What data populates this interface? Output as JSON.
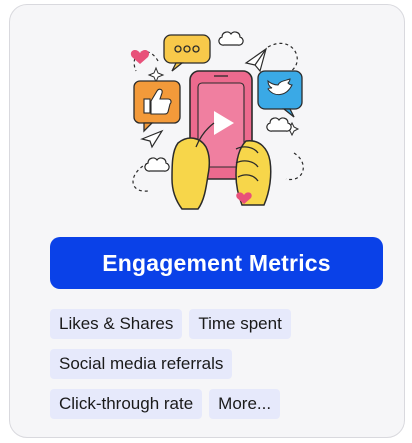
{
  "card": {
    "button_label": "Engagement Metrics",
    "tags": [
      "Likes & Shares",
      "Time spent",
      "Social media referrals",
      "Click-through rate",
      "More..."
    ]
  },
  "colors": {
    "accent": "#0a41e8",
    "tag_bg": "#e6e9fb",
    "phone": "#ec6a8e",
    "hand": "#f7d64a",
    "bubble_yellow": "#f8c94a",
    "bubble_blue": "#3aa9e6",
    "bubble_orange": "#f39a3a"
  },
  "illustration": {
    "icons": [
      "heart-icon",
      "chat-dots-icon",
      "thumbs-up-icon",
      "bird-icon",
      "play-icon",
      "paper-plane-icon",
      "cloud-icon",
      "sparkle-icon"
    ]
  }
}
